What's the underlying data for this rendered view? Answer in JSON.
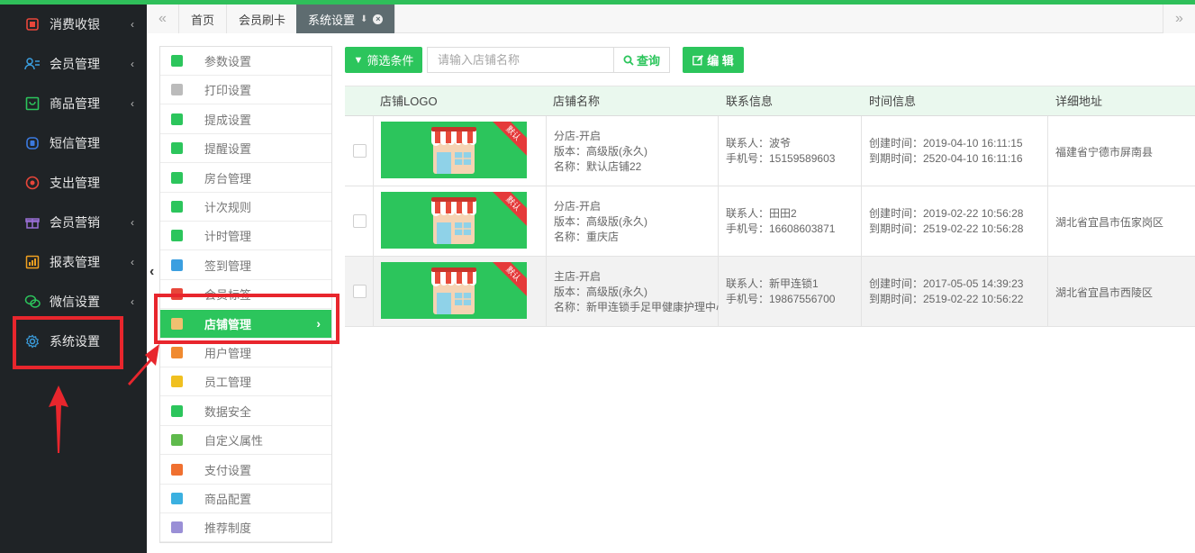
{
  "sidebar": {
    "items": [
      {
        "label": "消费收银",
        "icon": "cashier-icon",
        "color": "#e8463a",
        "has_caret": true
      },
      {
        "label": "会员管理",
        "icon": "members-icon",
        "color": "#3b9fe0",
        "has_caret": true
      },
      {
        "label": "商品管理",
        "icon": "goods-icon",
        "color": "#2cc55c",
        "has_caret": true
      },
      {
        "label": "短信管理",
        "icon": "sms-icon",
        "color": "#3b7ae0",
        "has_caret": false
      },
      {
        "label": "支出管理",
        "icon": "expense-icon",
        "color": "#e8463a",
        "has_caret": false
      },
      {
        "label": "会员营销",
        "icon": "gift-icon",
        "color": "#9a6fd6",
        "has_caret": true
      },
      {
        "label": "报表管理",
        "icon": "report-icon",
        "color": "#f0a020",
        "has_caret": true
      },
      {
        "label": "微信设置",
        "icon": "wechat-icon",
        "color": "#2cc55c",
        "has_caret": true
      },
      {
        "label": "系统设置",
        "icon": "gear-icon",
        "color": "#3b9fe0",
        "has_caret": false
      }
    ]
  },
  "tabs": [
    {
      "label": "首页",
      "active": false
    },
    {
      "label": "会员刷卡",
      "active": false
    },
    {
      "label": "系统设置",
      "active": true
    }
  ],
  "submenu": {
    "items": [
      {
        "label": "参数设置",
        "color": "#2cc55c"
      },
      {
        "label": "打印设置",
        "color": "#bbbbbb"
      },
      {
        "label": "提成设置",
        "color": "#2cc55c"
      },
      {
        "label": "提醒设置",
        "color": "#2cc55c"
      },
      {
        "label": "房台管理",
        "color": "#2cc55c"
      },
      {
        "label": "计次规则",
        "color": "#2cc55c"
      },
      {
        "label": "计时管理",
        "color": "#2cc55c"
      },
      {
        "label": "签到管理",
        "color": "#3b9fe0"
      },
      {
        "label": "会员标签",
        "color": "#e8463a"
      },
      {
        "label": "店铺管理",
        "color": "#f0a020",
        "active": true
      },
      {
        "label": "用户管理",
        "color": "#f08a30"
      },
      {
        "label": "员工管理",
        "color": "#f0c020"
      },
      {
        "label": "数据安全",
        "color": "#2cc55c"
      },
      {
        "label": "自定义属性",
        "color": "#5fba4c"
      },
      {
        "label": "支付设置",
        "color": "#f07030"
      },
      {
        "label": "商品配置",
        "color": "#3bb0e0"
      },
      {
        "label": "推荐制度",
        "color": "#9a8fd6"
      }
    ]
  },
  "toolbar": {
    "filter_label": "筛选条件",
    "search_placeholder": "请输入店铺名称",
    "query_label": "查询",
    "edit_label": "编 辑"
  },
  "table": {
    "columns": [
      "店铺LOGO",
      "店铺名称",
      "联系信息",
      "时间信息",
      "详细地址"
    ],
    "ribbon_text": "默认",
    "rows": [
      {
        "name_lines": [
          "分店-开启",
          "版本：高级版(永久)",
          "名称：默认店铺22"
        ],
        "contact_lines": [
          "联系人：波爷",
          "手机号：15159589603"
        ],
        "time_lines": [
          "创建时间：2019-04-10 16:11:15",
          "到期时间：2520-04-10 16:11:16"
        ],
        "address": "福建省宁德市屏南县",
        "highlight": false
      },
      {
        "name_lines": [
          "分店-开启",
          "版本：高级版(永久)",
          "名称：重庆店"
        ],
        "contact_lines": [
          "联系人：田田2",
          "手机号：16608603871"
        ],
        "time_lines": [
          "创建时间：2019-02-22 10:56:28",
          "到期时间：2519-02-22 10:56:28"
        ],
        "address": "湖北省宜昌市伍家岗区",
        "highlight": false
      },
      {
        "name_lines": [
          "主店-开启",
          "版本：高级版(永久)",
          "名称：新甲连锁手足甲健康护理中心"
        ],
        "contact_lines": [
          "联系人：新甲连锁1",
          "手机号：19867556700"
        ],
        "time_lines": [
          "创建时间：2017-05-05 14:39:23",
          "到期时间：2519-02-22 10:56:22"
        ],
        "address": "湖北省宜昌市西陵区",
        "highlight": true
      }
    ]
  },
  "colors": {
    "accent": "#2cc55c",
    "sidebar_bg": "#1f2326",
    "annotation": "#e8262d"
  }
}
